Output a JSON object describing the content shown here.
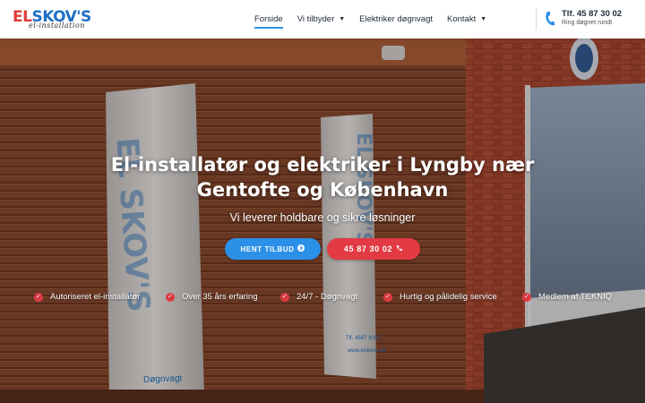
{
  "header": {
    "logo": {
      "brand_el": "EL",
      "brand_rest": "SKOV'S",
      "script": "el-installation"
    },
    "nav": [
      {
        "label": "Forside",
        "active": true,
        "has_dropdown": false
      },
      {
        "label": "Vi tilbyder",
        "active": false,
        "has_dropdown": true
      },
      {
        "label": "Elektriker døgnvagt",
        "active": false,
        "has_dropdown": false
      },
      {
        "label": "Kontakt",
        "active": false,
        "has_dropdown": true
      }
    ],
    "contact": {
      "phone": "Tlf. 45 87 30 02",
      "sub": "Ring døgnet rundt",
      "icon": "phone-icon"
    }
  },
  "hero": {
    "title": "El-installatør og elektriker i Lyngby nær Gentofte og København",
    "subtitle": "Vi leverer holdbare og sikre løsninger",
    "buttons": {
      "quote": {
        "label": "HENT TILBUD",
        "icon": "arrow-right-circle-icon"
      },
      "call": {
        "label": "45 87 30 02",
        "icon": "phone-icon"
      }
    },
    "features": [
      "Autoriseret el-installatør",
      "Over 35 års erfaring",
      "24/7 - Døgnvagt",
      "Hurtig og pålidelig service",
      "Medlem af TEKNIQ"
    ],
    "sign_text": {
      "brand": "EL SKOV'S",
      "tel": "Tlf. 4587 3002",
      "web": "www.elskovs.dk",
      "service": "Døgnvagt"
    }
  },
  "colors": {
    "primary_blue": "#2b90e8",
    "accent_red": "#e23b44",
    "nav_text": "#1e2a3a"
  }
}
